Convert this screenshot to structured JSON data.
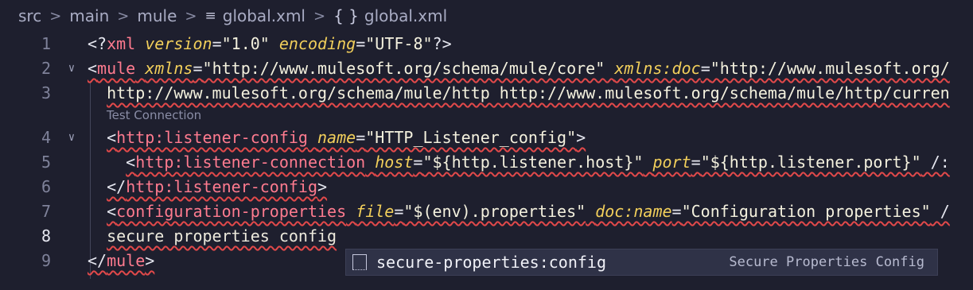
{
  "breadcrumb": {
    "items": [
      "src",
      "main",
      "mule",
      "global.xml",
      "global.xml"
    ]
  },
  "code_lens": "Test Connection",
  "lines": [
    {
      "num": "1",
      "tokens": [
        {
          "c": "punc",
          "t": "<?"
        },
        {
          "c": "tag",
          "t": "xml"
        },
        {
          "c": "punc",
          "t": " "
        },
        {
          "c": "attr",
          "t": "version"
        },
        {
          "c": "punc",
          "t": "="
        },
        {
          "c": "str",
          "t": "\"1.0\""
        },
        {
          "c": "punc",
          "t": " "
        },
        {
          "c": "attr",
          "t": "encoding"
        },
        {
          "c": "punc",
          "t": "="
        },
        {
          "c": "str",
          "t": "\"UTF-8\""
        },
        {
          "c": "punc",
          "t": "?>"
        }
      ]
    },
    {
      "num": "2",
      "fold": "expanded",
      "tokens": [
        {
          "c": "punc",
          "t": "<"
        },
        {
          "c": "tag",
          "t": "mule"
        },
        {
          "c": "punc",
          "t": " "
        },
        {
          "c": "attr",
          "t": "xmlns"
        },
        {
          "c": "punc",
          "t": "="
        },
        {
          "c": "str",
          "t": "\"http://www.mulesoft.org/schema/mule/core\""
        },
        {
          "c": "punc",
          "t": " "
        },
        {
          "c": "attr",
          "t": "xmlns:doc"
        },
        {
          "c": "punc",
          "t": "="
        },
        {
          "c": "str",
          "t": "\"http://www.mulesoft.org/"
        }
      ]
    },
    {
      "num": "3",
      "indent": "  ",
      "tokens": [
        {
          "c": "str",
          "t": "http://www.mulesoft.org/schema/mule/http http://www.mulesoft.org/schema/mule/http/curren"
        }
      ]
    },
    {
      "num": "4",
      "fold": "expanded",
      "indent": "  ",
      "tokens": [
        {
          "c": "punc",
          "t": "<"
        },
        {
          "c": "tag",
          "t": "http:listener-config"
        },
        {
          "c": "punc",
          "t": " "
        },
        {
          "c": "attr",
          "t": "name"
        },
        {
          "c": "punc",
          "t": "="
        },
        {
          "c": "str",
          "t": "\"HTTP_Listener_config\""
        },
        {
          "c": "punc",
          "t": ">"
        }
      ]
    },
    {
      "num": "5",
      "indent": "    ",
      "tokens": [
        {
          "c": "punc",
          "t": "<"
        },
        {
          "c": "tag",
          "t": "http:listener-connection"
        },
        {
          "c": "punc",
          "t": " "
        },
        {
          "c": "attr",
          "t": "host"
        },
        {
          "c": "punc",
          "t": "="
        },
        {
          "c": "str",
          "t": "\"${http.listener.host}\""
        },
        {
          "c": "punc",
          "t": " "
        },
        {
          "c": "attr",
          "t": "port"
        },
        {
          "c": "punc",
          "t": "="
        },
        {
          "c": "str",
          "t": "\"${http.listener.port}\""
        },
        {
          "c": "punc",
          "t": " /:"
        }
      ]
    },
    {
      "num": "6",
      "indent": "  ",
      "tokens": [
        {
          "c": "punc",
          "t": "</"
        },
        {
          "c": "tag",
          "t": "http:listener-config"
        },
        {
          "c": "punc",
          "t": ">"
        }
      ]
    },
    {
      "num": "7",
      "indent": "  ",
      "tokens": [
        {
          "c": "punc",
          "t": "<"
        },
        {
          "c": "tag",
          "t": "configuration-properties"
        },
        {
          "c": "punc",
          "t": " "
        },
        {
          "c": "attr",
          "t": "file"
        },
        {
          "c": "punc",
          "t": "="
        },
        {
          "c": "str",
          "t": "\"$(env).properties\""
        },
        {
          "c": "punc",
          "t": " "
        },
        {
          "c": "attr",
          "t": "doc:name"
        },
        {
          "c": "punc",
          "t": "="
        },
        {
          "c": "str",
          "t": "\"Configuration properties\""
        },
        {
          "c": "punc",
          "t": " /"
        }
      ]
    },
    {
      "num": "8",
      "active": true,
      "indent": "  ",
      "tokens": [
        {
          "c": "text",
          "t": "secure properties config"
        }
      ]
    },
    {
      "num": "9",
      "tokens": [
        {
          "c": "punc",
          "t": "</"
        },
        {
          "c": "tag",
          "t": "mule"
        },
        {
          "c": "punc",
          "t": ">"
        }
      ]
    }
  ],
  "suggestion": {
    "icon": "snippet-icon",
    "label": "secure-properties:config",
    "detail": "Secure Properties Config"
  },
  "colors": {
    "background": "#1e1f2e",
    "tag": "#ff7b8f",
    "attribute": "#f2cf5b",
    "string": "#f4f1de",
    "error_squiggle": "#e2494a"
  }
}
